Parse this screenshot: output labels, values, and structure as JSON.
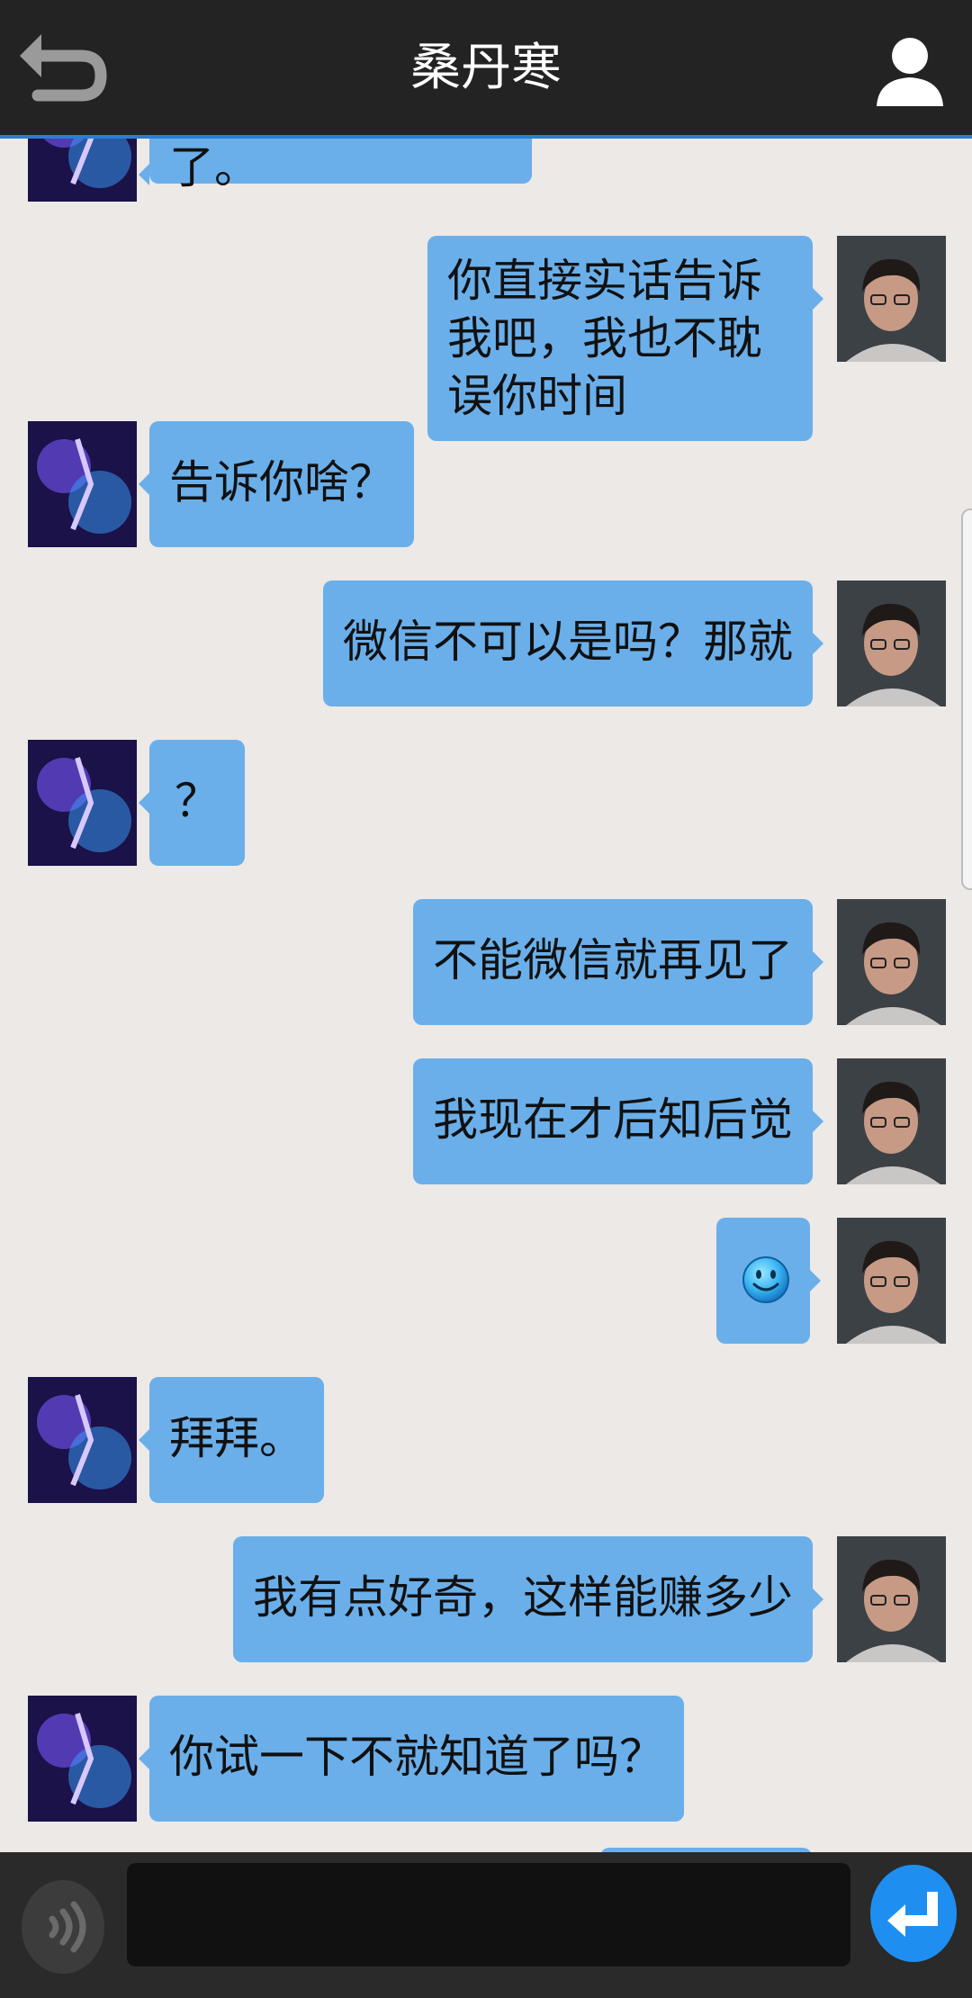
{
  "header": {
    "title": "桑丹寒"
  },
  "messages": [
    {
      "side": "left",
      "text": "他看到我就死了。"
    },
    {
      "side": "right",
      "text": "你直接实话告诉我吧，我也不耽误你时间"
    },
    {
      "side": "left",
      "text": "告诉你啥？"
    },
    {
      "side": "right",
      "text": "微信不可以是吗？那就"
    },
    {
      "side": "left",
      "text": "？"
    },
    {
      "side": "right",
      "text": "不能微信就再见了"
    },
    {
      "side": "right",
      "text": "我现在才后知后觉"
    },
    {
      "side": "right",
      "text": "",
      "emoji": "smiley-emoji"
    },
    {
      "side": "left",
      "text": "拜拜。"
    },
    {
      "side": "right",
      "text": "我有点好奇，这样能赚多少"
    },
    {
      "side": "left",
      "text": "你试一下不就知道了吗？"
    }
  ],
  "footer": {
    "input_value": "",
    "input_placeholder": ""
  },
  "icons": {
    "back": "back-arrow-icon",
    "profile": "person-icon",
    "voice": "voice-icon",
    "send": "enter-icon"
  },
  "colors": {
    "header_bg": "#232323",
    "header_accent": "#2a7fd4",
    "chat_bg": "#ece9e6",
    "bubble": "#6aafea",
    "footer_bg": "#2a2a2a",
    "send_button": "#1e8ff0"
  }
}
